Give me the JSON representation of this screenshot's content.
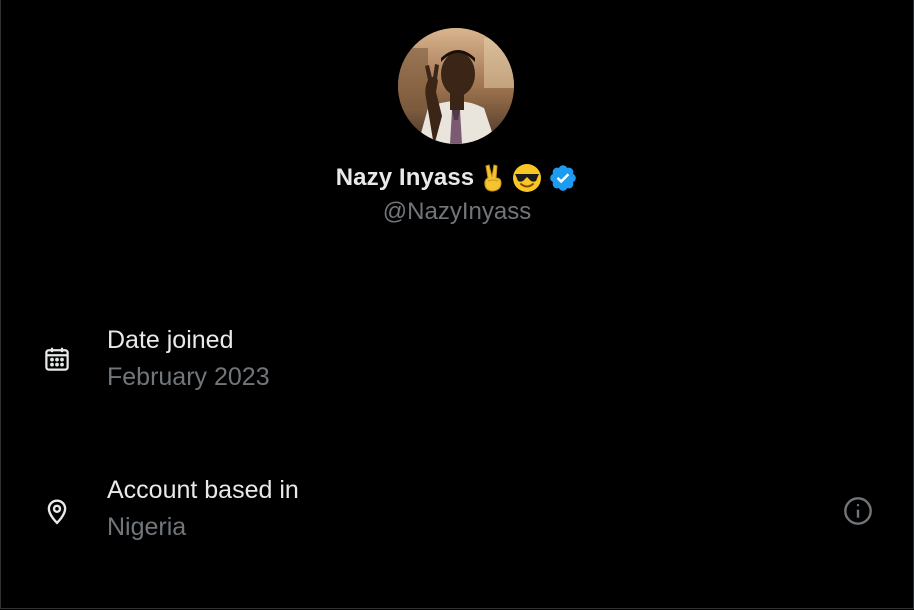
{
  "profile": {
    "display_name": "Nazy Inyass",
    "emoji_1": "✌",
    "emoji_2": "😎",
    "handle": "@NazyInyass",
    "verified": true,
    "verified_color": "#1d9bf0"
  },
  "details": {
    "date_joined": {
      "label": "Date joined",
      "value": "February 2023",
      "icon": "calendar-icon"
    },
    "account_based_in": {
      "label": "Account based in",
      "value": "Nigeria",
      "icon": "location-pin-icon",
      "info_icon": "info-icon"
    }
  },
  "colors": {
    "background": "#000000",
    "primary_text": "#e7e9ea",
    "secondary_text": "#71767b",
    "border": "#2f3336"
  }
}
